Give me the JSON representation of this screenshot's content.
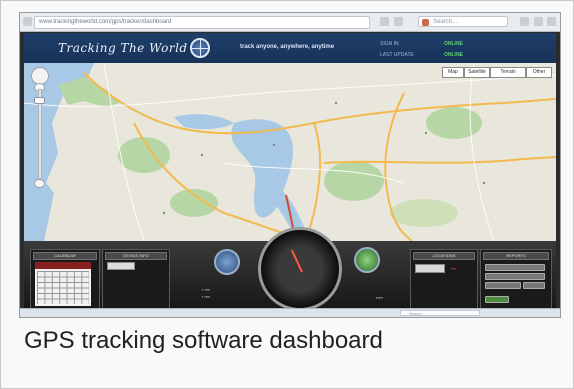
{
  "browser": {
    "url": "www.trackingtheworld.com/gps/tracker/dashboard",
    "search_placeholder": "Search..."
  },
  "header": {
    "logo": "Tracking The World",
    "tagline": "track anyone, anywhere, anytime",
    "labels": [
      "SIGN IN",
      "LAST UPDATE"
    ],
    "values": [
      "ONLINE",
      "ONLINE"
    ]
  },
  "map": {
    "type_buttons": [
      "Map",
      "Satellite",
      "Terrain",
      "Other"
    ]
  },
  "dashboard": {
    "panel_titles": [
      "CALENDAR",
      "DEVICE INFO",
      "LOCATIONS",
      "REPORTS"
    ],
    "button_labels": [
      "",
      "",
      "",
      ""
    ],
    "accent_color": "#8a1f1f",
    "gauge_needle_color": "#ff5a3c"
  },
  "caption": "GPS tracking software dashboard",
  "icons": [
    "globe-icon",
    "pan-control-icon",
    "zoom-in-icon",
    "zoom-out-icon",
    "search-icon",
    "compass-icon",
    "battery-icon"
  ]
}
